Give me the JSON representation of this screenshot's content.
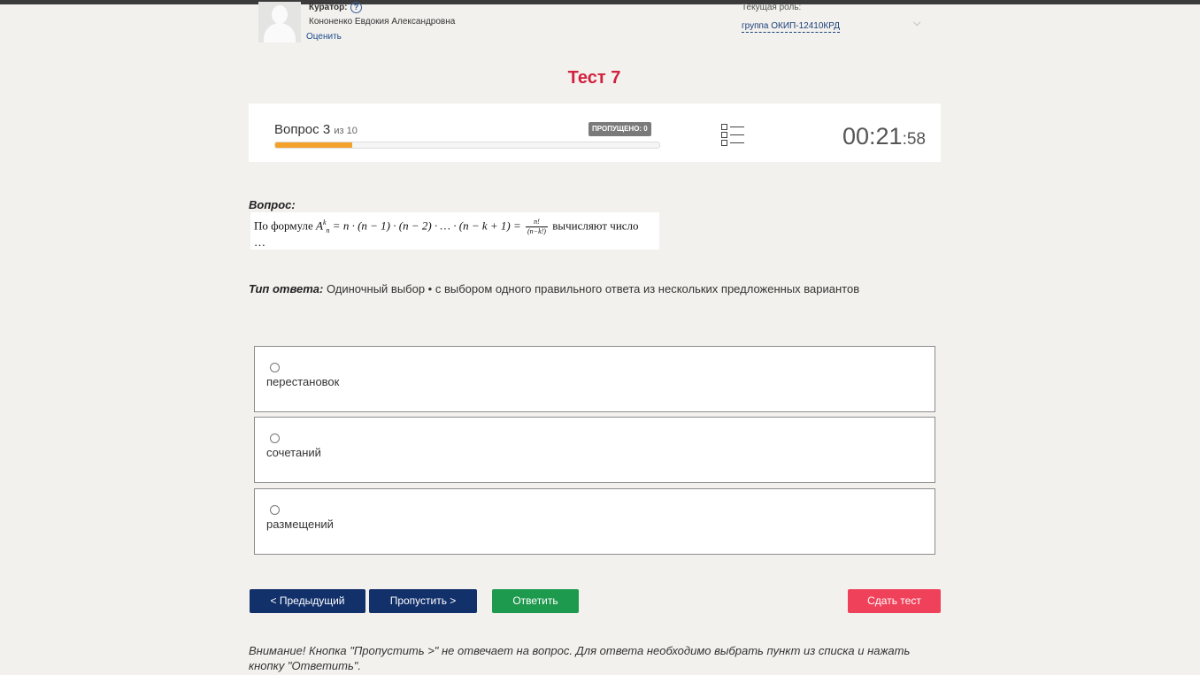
{
  "header": {
    "curator_label": "Куратор:",
    "help_glyph": "?",
    "curator_name": "Кононенко Евдокия Александровна",
    "rate_link": "Оценить",
    "role_label": "Текущая роль:",
    "role_value": "группа ОКИП-12410КРД",
    "role_chevron": "⌵"
  },
  "test": {
    "title": "Тест 7"
  },
  "progress": {
    "question_label": "Вопрос 3",
    "question_of": "из 10",
    "current": 3,
    "total": 10,
    "fill_fraction": 0.2,
    "skipped_badge": "ПРОПУЩЕНО: 0",
    "timer_main": "00:21",
    "timer_seconds": ":58"
  },
  "question": {
    "heading": "Вопрос:",
    "prefix": "По формуле",
    "formula_lhs": "A",
    "formula_sup": "k",
    "formula_sub": "n",
    "formula_body": "= n · (n − 1) · (n − 2) · … · (n − k + 1) =",
    "frac_num": "n!",
    "frac_den": "(n−k!)",
    "suffix": "вычисляют число",
    "ellipsis": "…"
  },
  "answer_type": {
    "label": "Тип ответа:",
    "value": "Одиночный выбор • с выбором одного правильного ответа из нескольких предложенных вариантов"
  },
  "answers": [
    {
      "text": "перестановок"
    },
    {
      "text": "сочетаний"
    },
    {
      "text": "размещений"
    }
  ],
  "buttons": {
    "prev": "< Предыдущий",
    "skip": "Пропустить >",
    "answer": "Ответить",
    "submit": "Сдать тест"
  },
  "warning": "Внимание! Кнопка \"Пропустить >\" не отвечает на вопрос. Для ответа необходимо выбрать пункт из списка и нажать кнопку \"Ответить\".",
  "colors": {
    "title": "#d3203e",
    "progress_fill": "#f3a12b",
    "nav_buttons": "#12306a",
    "answer_button": "#1e9a4e",
    "submit_button": "#f0415a"
  }
}
